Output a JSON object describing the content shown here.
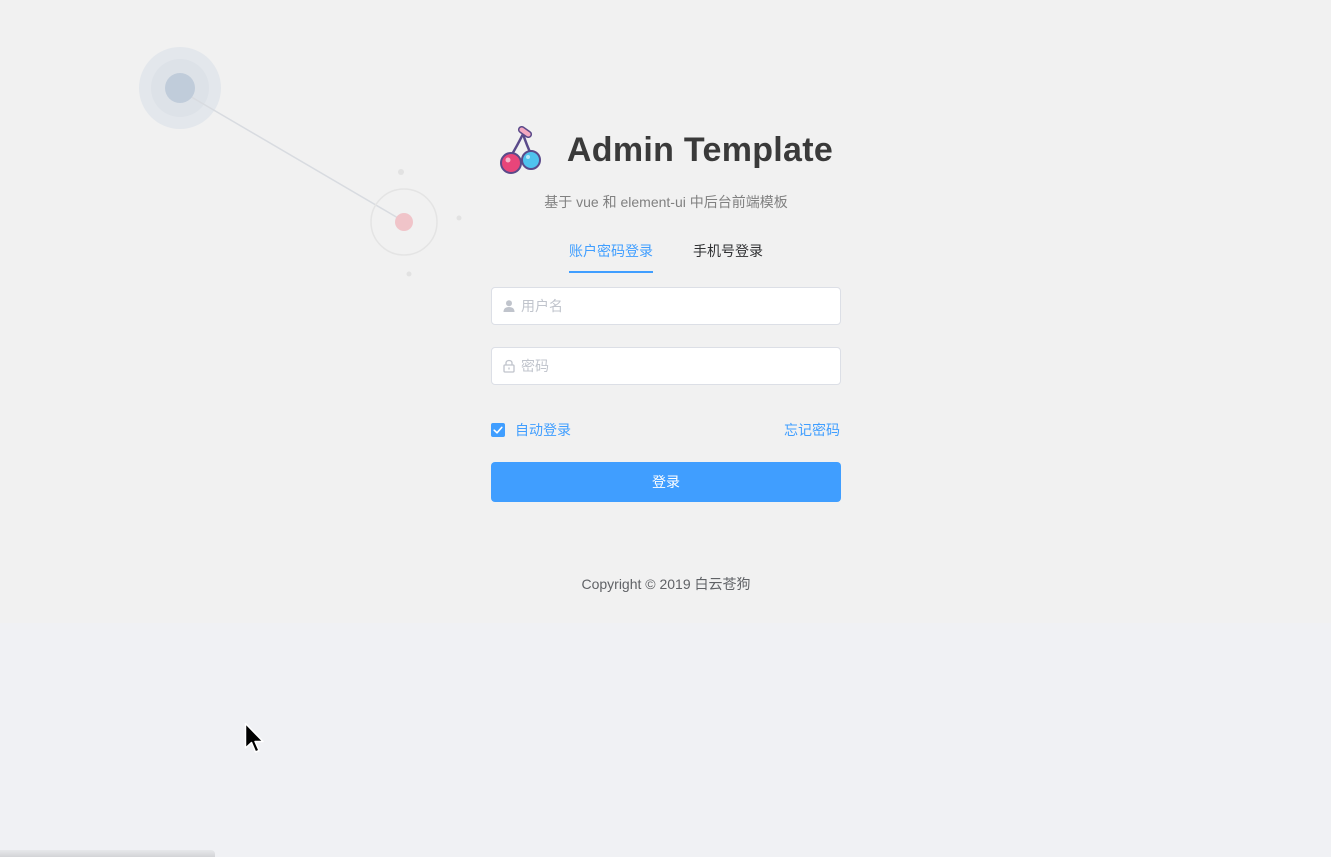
{
  "brand": {
    "title": "Admin Template",
    "subtitle": "基于 vue 和 element-ui 中后台前端模板",
    "logo_icon": "cherry-icon"
  },
  "tabs": [
    {
      "label": "账户密码登录",
      "active": true
    },
    {
      "label": "手机号登录",
      "active": false
    }
  ],
  "form": {
    "username": {
      "placeholder": "用户名",
      "value": "",
      "icon": "user-icon"
    },
    "password": {
      "placeholder": "密码",
      "value": "",
      "icon": "lock-icon"
    },
    "auto_login_label": "自动登录",
    "auto_login_checked": true,
    "forgot_label": "忘记密码",
    "submit_label": "登录"
  },
  "footer": {
    "copyright": "Copyright © 2019 白云苍狗"
  },
  "colors": {
    "primary": "#409eff",
    "title": "#3a3a3a",
    "background_top": "#f1f1f1",
    "background_bottom": "#f0f1f4"
  }
}
